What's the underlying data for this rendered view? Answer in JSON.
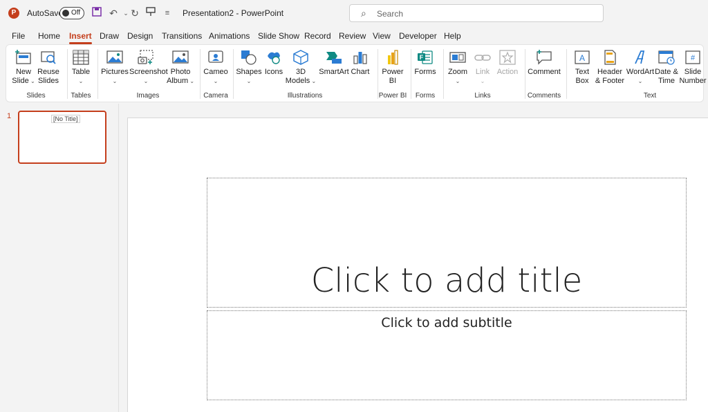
{
  "titlebar": {
    "app_icon_letter": "P",
    "autosave_label": "AutoSave",
    "autosave_state": "Off",
    "doc_title": "Presentation2  -  PowerPoint",
    "search_placeholder": "Search",
    "quick_access_icons": [
      "save-icon",
      "undo-icon",
      "redo-icon",
      "present-icon",
      "customize-icon"
    ]
  },
  "tabs": [
    "File",
    "Home",
    "Insert",
    "Draw",
    "Design",
    "Transitions",
    "Animations",
    "Slide Show",
    "Record",
    "Review",
    "View",
    "Developer",
    "Help"
  ],
  "active_tab": "Insert",
  "ribbon": {
    "groups": [
      "Slides",
      "Tables",
      "Images",
      "Camera",
      "Illustrations",
      "Power BI",
      "Forms",
      "Links",
      "Comments",
      "Text"
    ],
    "buttons": {
      "new_slide": [
        "New",
        "Slide"
      ],
      "reuse_slides": [
        "Reuse",
        "Slides"
      ],
      "table": "Table",
      "pictures": "Pictures",
      "screenshot": "Screenshot",
      "photo_album": [
        "Photo",
        "Album"
      ],
      "cameo": "Cameo",
      "shapes": "Shapes",
      "icons": "Icons",
      "models_3d": [
        "3D",
        "Models"
      ],
      "smartart": "SmartArt",
      "chart": "Chart",
      "power_bi": [
        "Power",
        "BI"
      ],
      "forms": "Forms",
      "zoom": "Zoom",
      "link": "Link",
      "action": "Action",
      "comment": "Comment",
      "text_box": [
        "Text",
        "Box"
      ],
      "header_footer": [
        "Header",
        "& Footer"
      ],
      "wordart": "WordArt",
      "date_time": [
        "Date &",
        "Time"
      ],
      "slide_number": [
        "Slide",
        "Number"
      ]
    }
  },
  "slides_panel": {
    "slide_number": "1",
    "thumb_title": "[No Title]"
  },
  "slide": {
    "title_placeholder": "Click to add title",
    "subtitle_placeholder": "Click to add subtitle"
  },
  "colors": {
    "accent": "#c43e1c",
    "icon_blue": "#2b7cd3",
    "icon_teal": "#0f8a83"
  }
}
